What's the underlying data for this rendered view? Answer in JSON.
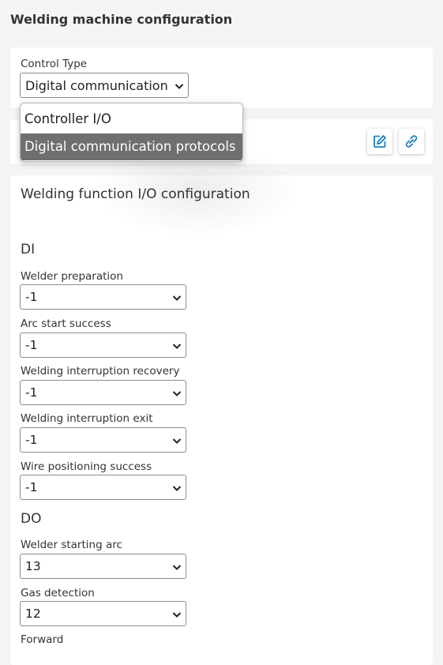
{
  "page": {
    "title": "Welding machine configuration"
  },
  "control": {
    "label": "Control Type",
    "value": "Digital communication protocols",
    "options": [
      "Controller I/O",
      "Digital communication protocols"
    ]
  },
  "io": {
    "title": "Welding function I/O configuration",
    "di": {
      "title": "DI",
      "fields": [
        {
          "label": "Welder preparation",
          "value": "-1"
        },
        {
          "label": "Arc start success",
          "value": "-1"
        },
        {
          "label": "Welding interruption recovery",
          "value": "-1"
        },
        {
          "label": "Welding interruption exit",
          "value": "-1"
        },
        {
          "label": "Wire positioning success",
          "value": "-1"
        }
      ]
    },
    "do": {
      "title": "DO",
      "fields": [
        {
          "label": "Welder starting arc",
          "value": "13"
        },
        {
          "label": "Gas detection",
          "value": "12"
        },
        {
          "label": "Forward",
          "value": ""
        }
      ]
    }
  },
  "colors": {
    "accent": "#1a7fc1",
    "highlight": "#6f6f6f"
  },
  "icons": [
    "edit-icon",
    "link-icon",
    "chevron-down-icon"
  ]
}
